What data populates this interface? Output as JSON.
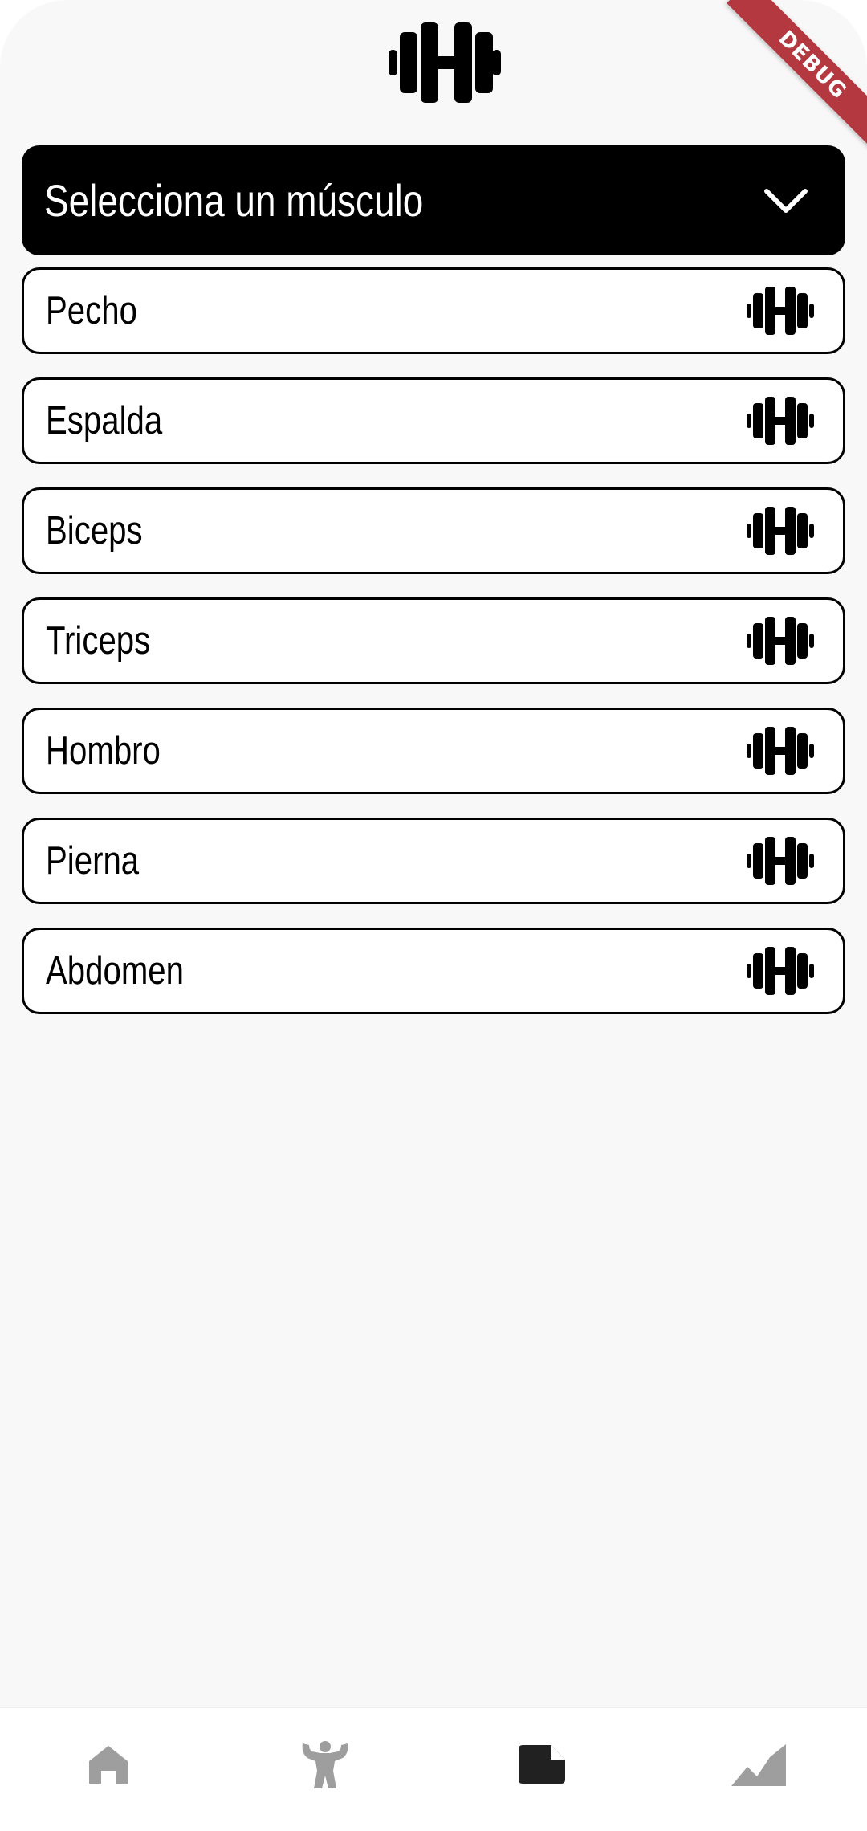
{
  "header": {
    "logo_icon": "dumbbell-icon",
    "debug_banner": "DEBUG"
  },
  "dropdown": {
    "label": "Selecciona un músculo",
    "icon": "chevron-down-icon"
  },
  "muscles": [
    {
      "label": "Pecho",
      "icon": "dumbbell-icon"
    },
    {
      "label": "Espalda",
      "icon": "dumbbell-icon"
    },
    {
      "label": "Biceps",
      "icon": "dumbbell-icon"
    },
    {
      "label": "Triceps",
      "icon": "dumbbell-icon"
    },
    {
      "label": "Hombro",
      "icon": "dumbbell-icon"
    },
    {
      "label": "Pierna",
      "icon": "dumbbell-icon"
    },
    {
      "label": "Abdomen",
      "icon": "dumbbell-icon"
    }
  ],
  "bottom_nav": {
    "items": [
      {
        "icon": "home-icon",
        "active": false
      },
      {
        "icon": "bodybuilder-icon",
        "active": false
      },
      {
        "icon": "note-icon",
        "active": true
      },
      {
        "icon": "chart-area-icon",
        "active": false
      }
    ]
  },
  "colors": {
    "background": "#f8f8f8",
    "primary": "#000000",
    "inactive_icon": "#9e9e9e",
    "active_icon": "#212121",
    "debug_ribbon": "#b3383f"
  }
}
